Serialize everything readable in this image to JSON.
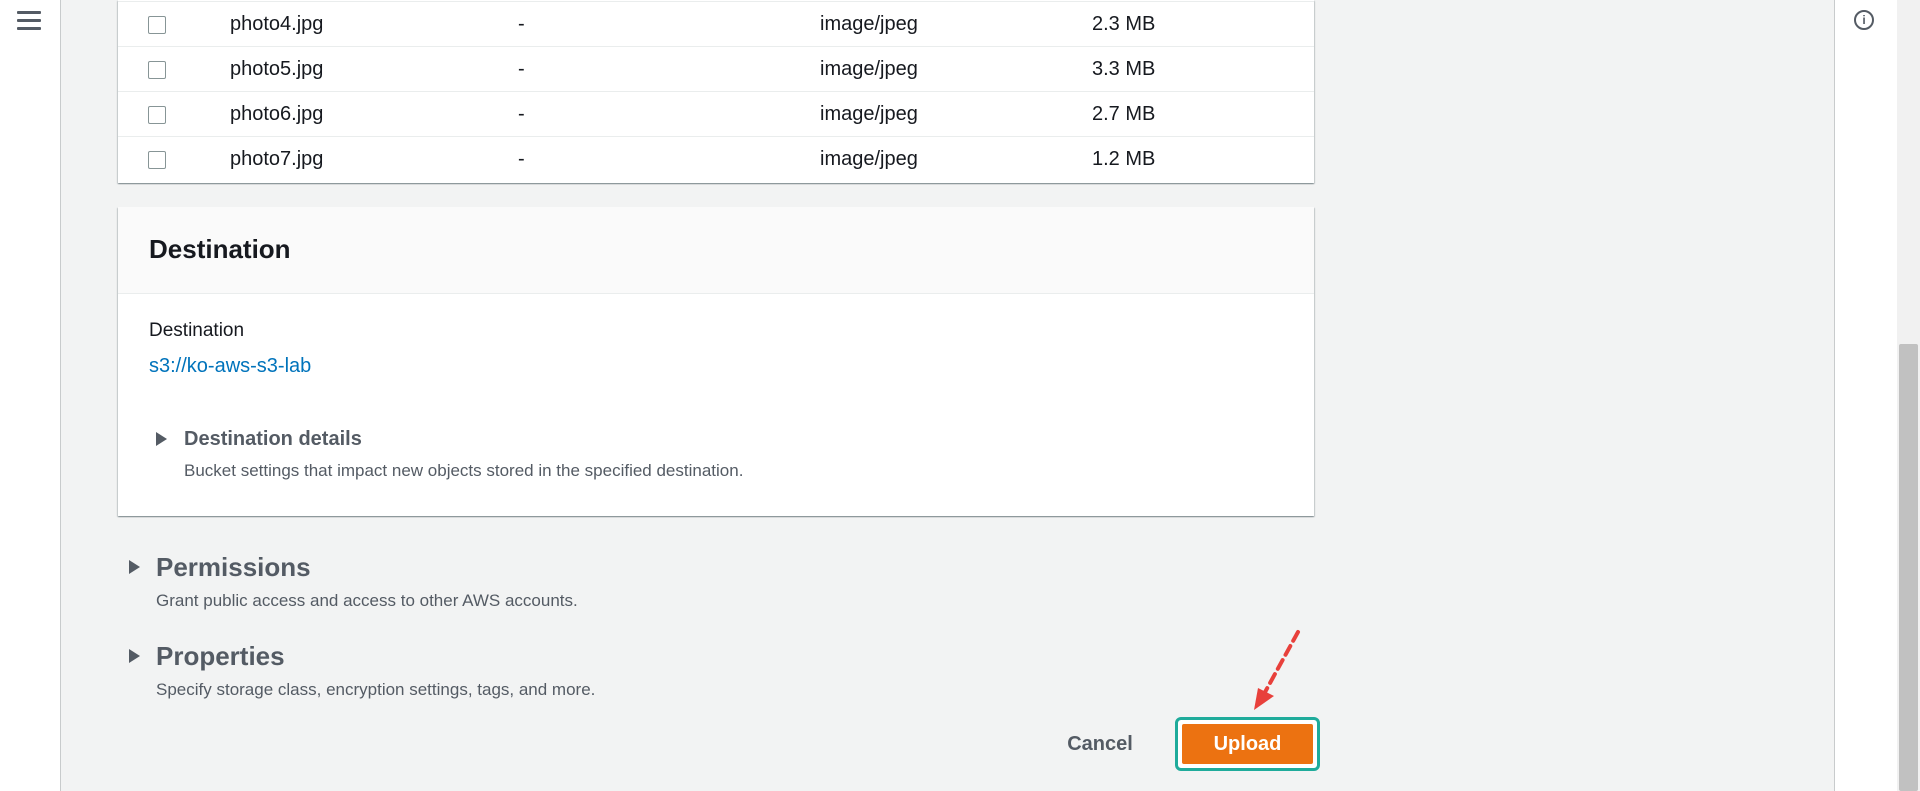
{
  "app": {
    "menu_icon": "hamburger-menu-icon",
    "info_icon": "info-circle-icon",
    "info_glyph": "i"
  },
  "files": [
    {
      "name": "photo4.jpg",
      "folder": "-",
      "type": "image/jpeg",
      "size": "2.3 MB"
    },
    {
      "name": "photo5.jpg",
      "folder": "-",
      "type": "image/jpeg",
      "size": "3.3 MB"
    },
    {
      "name": "photo6.jpg",
      "folder": "-",
      "type": "image/jpeg",
      "size": "2.7 MB"
    },
    {
      "name": "photo7.jpg",
      "folder": "-",
      "type": "image/jpeg",
      "size": "1.2 MB"
    }
  ],
  "destination": {
    "title": "Destination",
    "label": "Destination",
    "link": "s3://ko-aws-s3-lab",
    "details_title": "Destination details",
    "details_desc": "Bucket settings that impact new objects stored in the specified destination."
  },
  "permissions": {
    "title": "Permissions",
    "desc": "Grant public access and access to other AWS accounts."
  },
  "properties": {
    "title": "Properties",
    "desc": "Specify storage class, encryption settings, tags, and more."
  },
  "actions": {
    "cancel_label": "Cancel",
    "upload_label": "Upload"
  },
  "colors": {
    "primary_button": "#ec7211",
    "link": "#0073bb",
    "highlight_outline": "#1fab9b",
    "annotation_arrow": "#e8403b"
  }
}
